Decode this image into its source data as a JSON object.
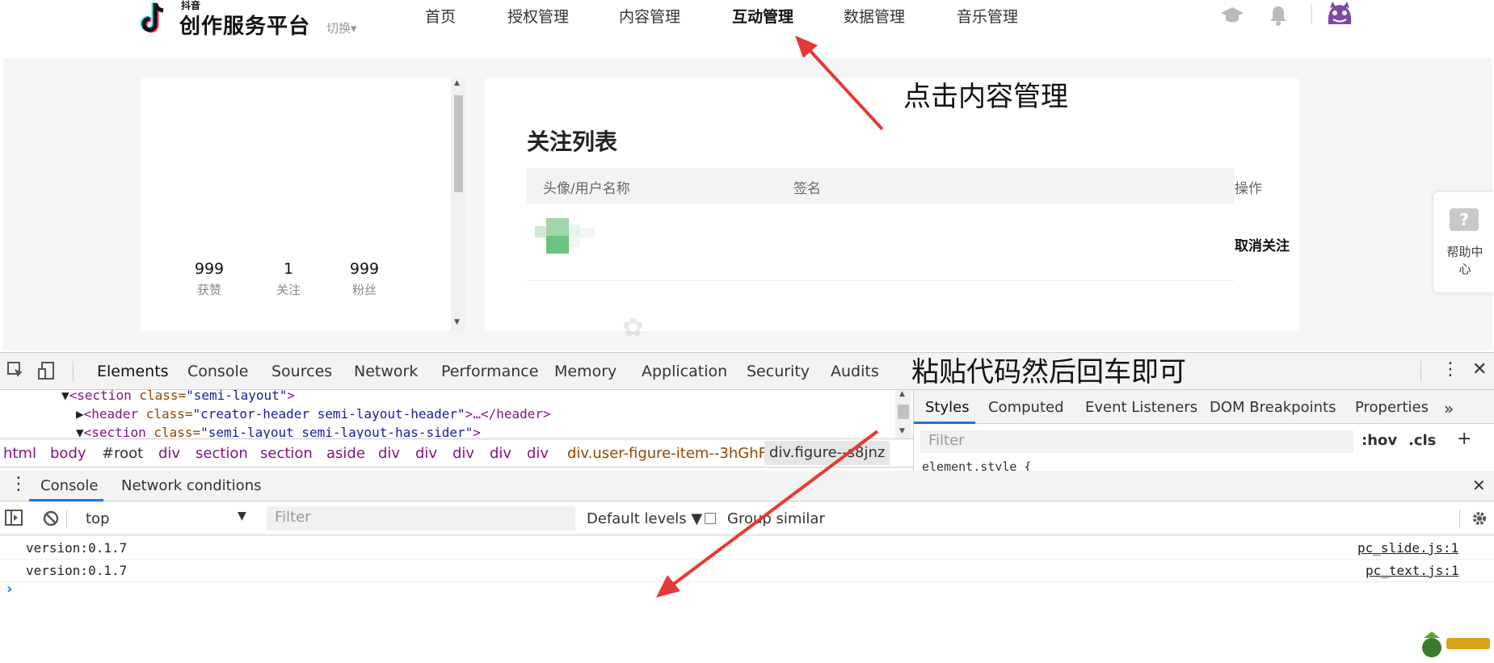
{
  "header": {
    "brand_small": "抖音",
    "brand_name": "创作服务平台",
    "switch_label": "切换▾",
    "nav": [
      "首页",
      "授权管理",
      "内容管理",
      "互动管理",
      "数据管理",
      "音乐管理"
    ],
    "active_nav": "互动管理"
  },
  "profile": {
    "stats": [
      {
        "num": "999",
        "label": "获赞"
      },
      {
        "num": "1",
        "label": "关注"
      },
      {
        "num": "999",
        "label": "粉丝"
      }
    ]
  },
  "follow_list": {
    "title": "关注列表",
    "columns": [
      "头像/用户名称",
      "签名",
      "操作"
    ],
    "rows": [
      {
        "action": "取消关注"
      }
    ]
  },
  "help": {
    "label": "帮助中心",
    "icon_glyph": "?"
  },
  "annotations": {
    "top": "点击内容管理",
    "devtools": "粘贴代码然后回车即可"
  },
  "devtools": {
    "tabs": [
      "Elements",
      "Console",
      "Sources",
      "Network",
      "Performance",
      "Memory",
      "Application",
      "Security",
      "Audits"
    ],
    "selected_tab": "Elements",
    "dom_lines": [
      {
        "arrow": "▼",
        "tag_open": "<section",
        "attr": " class=",
        "val": "\"semi-layout\"",
        "tag_close": ">",
        "rest": ""
      },
      {
        "arrow": "▶",
        "tag_open": "<header",
        "attr": " class=",
        "val": "\"creator-header semi-layout-header\"",
        "tag_close": ">",
        "rest": "…</header>"
      },
      {
        "arrow": "▼",
        "tag_open": "<section",
        "attr": " class=",
        "val": "\"semi-layout semi-layout-has-sider\"",
        "tag_close": ">",
        "rest": ""
      }
    ],
    "breadcrumb": [
      "html",
      "body",
      "#root",
      "div",
      "section",
      "section",
      "aside",
      "div",
      "div",
      "div",
      "div",
      "div",
      "div.user-figure-item--3hGhF",
      "div.figure--s8jnz"
    ],
    "styles_tabs": [
      "Styles",
      "Computed",
      "Event Listeners",
      "DOM Breakpoints",
      "Properties",
      "»"
    ],
    "styles_filter_placeholder": "Filter",
    "hov": ":hov",
    "cls": ".cls",
    "plus": "+",
    "element_style": "element.style {",
    "drawer_tabs": [
      "Console",
      "Network conditions"
    ],
    "context": "top",
    "console_filter_placeholder": "Filter",
    "levels": "Default levels ▼",
    "group_similar": "Group similar",
    "logs": [
      {
        "msg": "version:0.1.7",
        "src": "pc_slide.js:1"
      },
      {
        "msg": "version:0.1.7",
        "src": "pc_text.js:1"
      }
    ],
    "prompt": "›"
  },
  "colors": {
    "accent": "#1a73e8",
    "arrow": "#e53935",
    "page_bg": "#f4f5f7"
  }
}
